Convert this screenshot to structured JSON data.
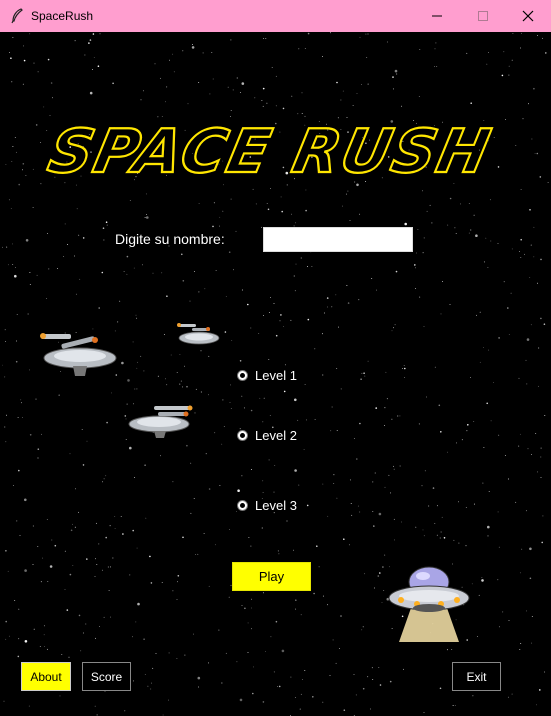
{
  "window": {
    "title": "SpaceRush",
    "icons": {
      "app": "feather-icon",
      "minimize": "minimize-icon",
      "maximize": "maximize-icon",
      "close": "close-icon"
    },
    "titlebar_color": "#ff9ecf"
  },
  "game": {
    "title": "SPACE RUSH",
    "title_color": "#ffe600",
    "name_label": "Digite su nombre:",
    "name_value": "",
    "levels": [
      {
        "label": "Level 1"
      },
      {
        "label": "Level 2"
      },
      {
        "label": "Level 3"
      }
    ],
    "play_label": "Play",
    "about_label": "About",
    "score_label": "Score",
    "exit_label": "Exit",
    "accent_color": "#ffff00",
    "sprites": [
      "starship-icon",
      "starship-icon",
      "starship-icon",
      "ufo-icon"
    ]
  }
}
